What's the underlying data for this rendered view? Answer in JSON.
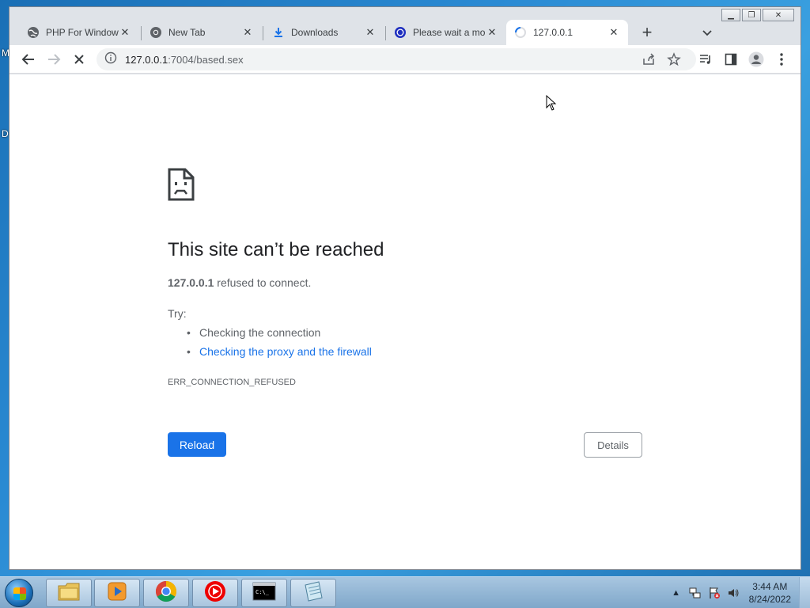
{
  "desktop": {
    "left_letters": [
      "M",
      "D"
    ]
  },
  "browser": {
    "window_controls": {
      "minimize": "▁",
      "restore": "❐",
      "close": "✕"
    },
    "tabs": [
      {
        "title": "PHP For Windows",
        "icon": "globe-icon",
        "close": "✕",
        "active": false
      },
      {
        "title": "New Tab",
        "icon": "chrome-icon",
        "close": "✕",
        "active": false
      },
      {
        "title": "Downloads",
        "icon": "download-icon",
        "close": "✕",
        "active": false
      },
      {
        "title": "Please wait a moment",
        "icon": "loading-blue-icon",
        "close": "✕",
        "active": false
      },
      {
        "title": "127.0.0.1",
        "icon": "spinner-icon",
        "close": "✕",
        "active": true
      }
    ],
    "new_tab_label": "+",
    "address": {
      "host": "127.0.0.1",
      "path": ":7004/based.sex"
    }
  },
  "error_page": {
    "title": "This site can’t be reached",
    "host": "127.0.0.1",
    "description_suffix": " refused to connect.",
    "try_label": "Try:",
    "suggestions": [
      {
        "text": "Checking the connection",
        "link": false
      },
      {
        "text": "Checking the proxy and the firewall",
        "link": true
      }
    ],
    "error_code": "ERR_CONNECTION_REFUSED",
    "reload_label": "Reload",
    "details_label": "Details"
  },
  "taskbar": {
    "apps": [
      "file-explorer-icon",
      "media-player-icon",
      "chrome-icon",
      "youtube-music-icon",
      "command-prompt-icon",
      "notepad-icon"
    ],
    "tray_arrow": "▲",
    "time": "3:44 AM",
    "date": "8/24/2022"
  },
  "colors": {
    "accent": "#1a73e8",
    "text_secondary": "#5f6368"
  }
}
